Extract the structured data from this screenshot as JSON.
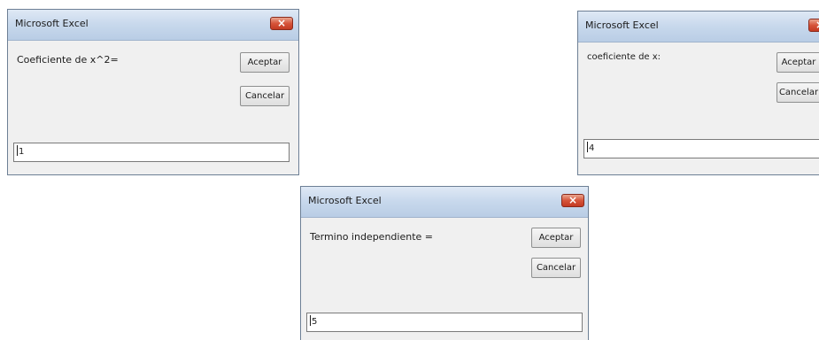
{
  "dialogs": [
    {
      "title": "Microsoft Excel",
      "prompt": "Coeficiente de x^2=",
      "accept_label": "Aceptar",
      "cancel_label": "Cancelar",
      "input_value": "1"
    },
    {
      "title": "Microsoft Excel",
      "prompt": "coeficiente de x:",
      "accept_label": "Aceptar",
      "cancel_label": "Cancelar",
      "input_value": "4"
    },
    {
      "title": "Microsoft Excel",
      "prompt": "Termino independiente =",
      "accept_label": "Aceptar",
      "cancel_label": "Cancelar",
      "input_value": "5"
    }
  ],
  "icons": {
    "close": "close-icon"
  },
  "colors": {
    "titlebar": "#c7d8ec",
    "close_button": "#d6543a",
    "dialog_body": "#f0f0f0"
  }
}
